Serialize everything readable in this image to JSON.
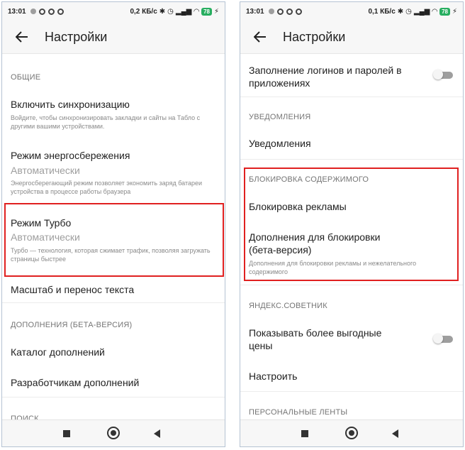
{
  "left": {
    "status": {
      "time": "13:01",
      "right_text": "0,2 КБ/с",
      "battery": "78"
    },
    "appbar": {
      "title": "Настройки"
    },
    "items": {
      "general_header": "ОБЩИЕ",
      "sync_title": "Включить синхронизацию",
      "sync_desc": "Войдите, чтобы синхронизировать закладки и сайты на Табло с другими вашими устройствами.",
      "energy_title": "Режим энергосбережения",
      "energy_value": "Автоматически",
      "energy_desc": "Энергосберегающий режим позволяет экономить заряд батареи устройства в процессе работы браузера",
      "turbo_title": "Режим Турбо",
      "turbo_value": "Автоматически",
      "turbo_desc": "Турбо — технология, которая сжимает трафик, позволяя загружать страницы быстрее",
      "scale_title": "Масштаб и перенос текста",
      "addons_header": "ДОПОЛНЕНИЯ (БЕТА-ВЕРСИЯ)",
      "catalog_title": "Каталог дополнений",
      "dev_title": "Разработчикам дополнений",
      "search_header": "ПОИСК"
    }
  },
  "right": {
    "status": {
      "time": "13:01",
      "right_text": "0,1 КБ/с",
      "battery": "78"
    },
    "appbar": {
      "title": "Настройки"
    },
    "items": {
      "autofill_title": "Заполнение логинов и паролей в приложениях",
      "notif_header": "УВЕДОМЛЕНИЯ",
      "notif_title": "Уведомления",
      "block_header": "БЛОКИРОВКА СОДЕРЖИМОГО",
      "adblock_title": "Блокировка рекламы",
      "blockaddons_title": "Дополнения для блокировки (бета-версия)",
      "blockaddons_desc": "Дополнения для блокировки рекламы и нежелательного содержимого",
      "advisor_header": "ЯНДЕКС.СОВЕТНИК",
      "advisor_title": "Показывать более выгодные цены",
      "configure_title": "Настроить",
      "feeds_header": "ПЕРСОНАЛЬНЫЕ ЛЕНТЫ"
    }
  },
  "colors": {
    "highlight": "#e02020",
    "battery": "#27ae60"
  }
}
